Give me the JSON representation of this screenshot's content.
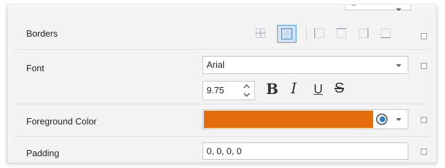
{
  "properties": {
    "borders": {
      "label": "Borders"
    },
    "font": {
      "label": "Font",
      "value": "Arial"
    },
    "font_size": {
      "value": "9.75"
    },
    "font_style": {
      "bold_label": "B",
      "italic_label": "I",
      "underline_label": "U",
      "strike_label": "S"
    },
    "foreground_color": {
      "label": "Foreground Color",
      "color": "#e46c0a"
    },
    "padding": {
      "label": "Padding",
      "value": "0, 0, 0, 0"
    }
  },
  "colors": {
    "panel_bg": "#f3f3f3",
    "selected_button_bg": "#cfe5f7",
    "selected_button_border": "#5a9bd5",
    "swatch": "#e46c0a"
  }
}
